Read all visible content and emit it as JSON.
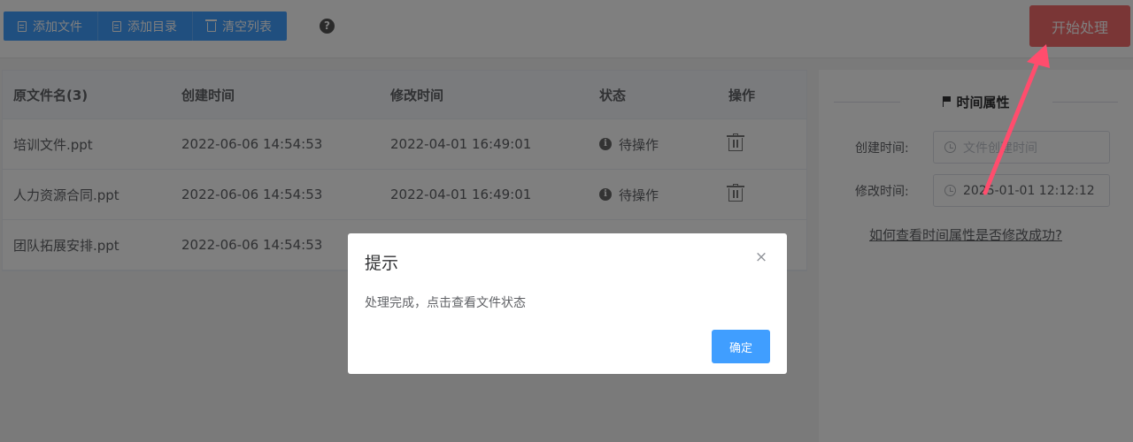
{
  "toolbar": {
    "add_file": "添加文件",
    "add_dir": "添加目录",
    "clear_list": "清空列表",
    "help": "?",
    "start": "开始处理"
  },
  "table": {
    "headers": [
      "原文件名(3)",
      "创建时间",
      "修改时间",
      "状态",
      "操作"
    ],
    "rows": [
      {
        "name": "培训文件.ppt",
        "created": "2022-06-06 14:54:53",
        "modified": "2022-04-01 16:49:01",
        "status": "待操作"
      },
      {
        "name": "人力资源合同.ppt",
        "created": "2022-06-06 14:54:53",
        "modified": "2022-04-01 16:49:01",
        "status": "待操作"
      },
      {
        "name": "团队拓展安排.ppt",
        "created": "2022-06-06 14:54:53",
        "modified": "",
        "status": ""
      }
    ]
  },
  "panel": {
    "title": "时间属性",
    "created_label": "创建时间:",
    "created_placeholder": "文件创建时间",
    "modified_label": "修改时间:",
    "modified_value": "2025-01-01 12:12:12",
    "help_link": "如何查看时间属性是否修改成功?"
  },
  "dialog": {
    "title": "提示",
    "message": "处理完成，点击查看文件状态",
    "close": "×",
    "ok": "确定"
  },
  "colors": {
    "primary": "#409eff",
    "danger": "#f56c6c",
    "arrow": "#ff4d6d"
  }
}
